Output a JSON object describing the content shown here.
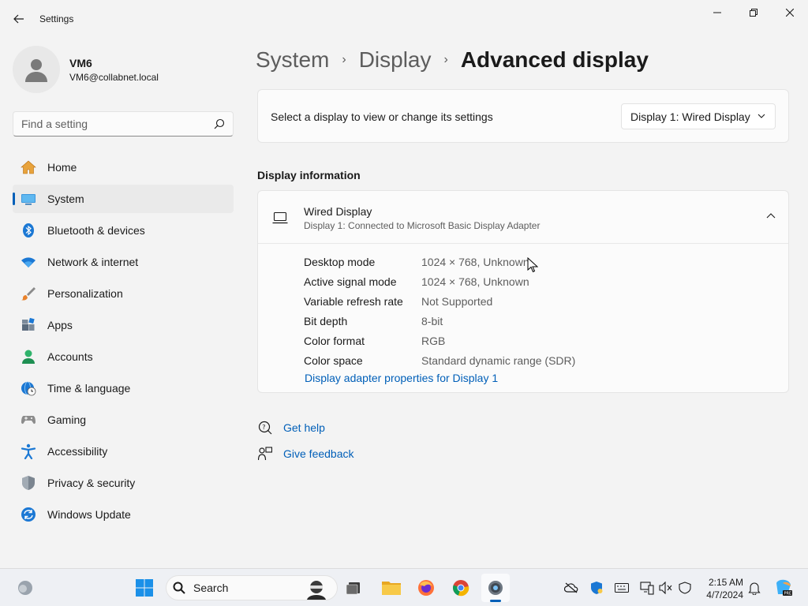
{
  "window": {
    "title": "Settings"
  },
  "user": {
    "name": "VM6",
    "email": "VM6@collabnet.local"
  },
  "search": {
    "placeholder": "Find a setting"
  },
  "nav": [
    {
      "label": "Home",
      "icon": "home-icon",
      "active": false
    },
    {
      "label": "System",
      "icon": "system-icon",
      "active": true
    },
    {
      "label": "Bluetooth & devices",
      "icon": "bluetooth-icon",
      "active": false
    },
    {
      "label": "Network & internet",
      "icon": "wifi-icon",
      "active": false
    },
    {
      "label": "Personalization",
      "icon": "brush-icon",
      "active": false
    },
    {
      "label": "Apps",
      "icon": "apps-icon",
      "active": false
    },
    {
      "label": "Accounts",
      "icon": "accounts-icon",
      "active": false
    },
    {
      "label": "Time & language",
      "icon": "globe-clock-icon",
      "active": false
    },
    {
      "label": "Gaming",
      "icon": "controller-icon",
      "active": false
    },
    {
      "label": "Accessibility",
      "icon": "accessibility-icon",
      "active": false
    },
    {
      "label": "Privacy & security",
      "icon": "shield-icon",
      "active": false
    },
    {
      "label": "Windows Update",
      "icon": "update-icon",
      "active": false
    }
  ],
  "breadcrumb": {
    "first": "System",
    "second": "Display",
    "current": "Advanced display",
    "separator": "›"
  },
  "display_select": {
    "label": "Select a display to view or change its settings",
    "value": "Display 1: Wired Display"
  },
  "display_info": {
    "section_title": "Display information",
    "title": "Wired Display",
    "subtitle": "Display 1: Connected to Microsoft Basic Display Adapter",
    "rows": [
      {
        "key": "Desktop mode",
        "value": "1024 × 768, Unknown"
      },
      {
        "key": "Active signal mode",
        "value": "1024 × 768, Unknown"
      },
      {
        "key": "Variable refresh rate",
        "value": "Not Supported"
      },
      {
        "key": "Bit depth",
        "value": "8-bit"
      },
      {
        "key": "Color format",
        "value": "RGB"
      },
      {
        "key": "Color space",
        "value": "Standard dynamic range (SDR)"
      }
    ],
    "link": "Display adapter properties for Display 1"
  },
  "help": {
    "get_help": "Get help",
    "give_feedback": "Give feedback"
  },
  "taskbar": {
    "search_label": "Search",
    "time": "2:15 AM",
    "date": "4/7/2024"
  },
  "colors": {
    "accent": "#005fb8",
    "background": "#f3f3f3",
    "card": "#fbfbfb"
  }
}
